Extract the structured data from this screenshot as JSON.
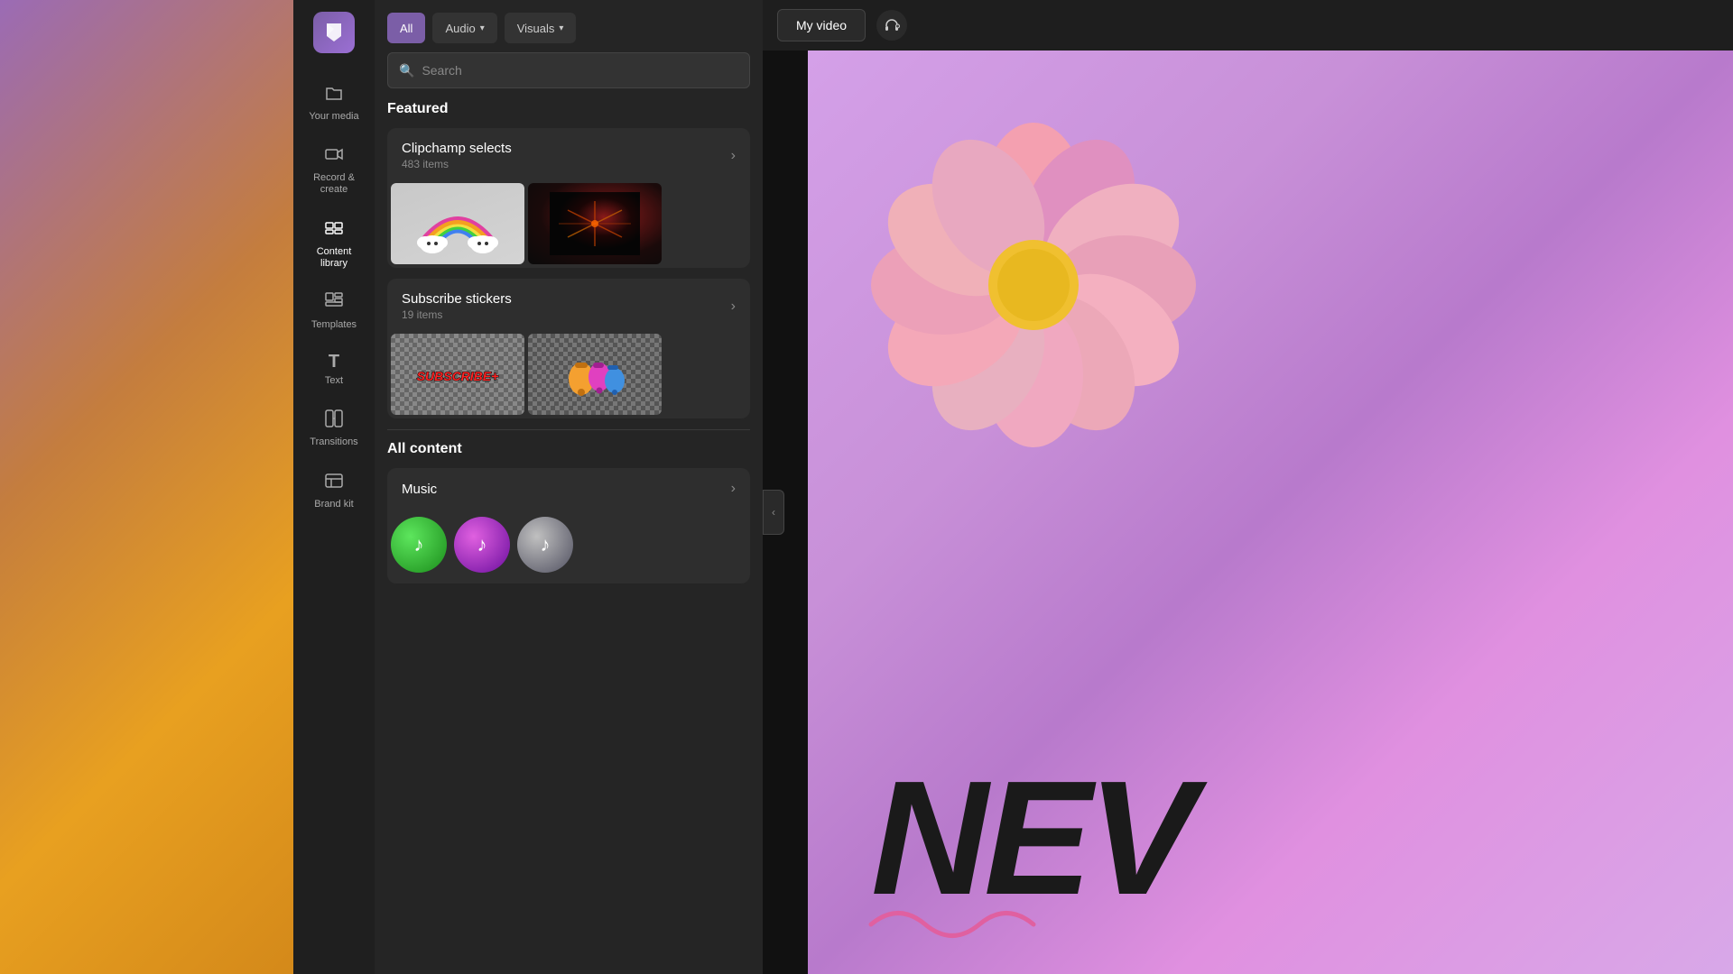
{
  "app": {
    "logo_label": "Clipchamp"
  },
  "sidebar": {
    "items": [
      {
        "id": "your-media",
        "label": "Your media",
        "icon": "📁"
      },
      {
        "id": "record-create",
        "label": "Record &\ncreate",
        "icon": "🎥"
      },
      {
        "id": "content-library",
        "label": "Content library",
        "icon": "🎞️",
        "active": true
      },
      {
        "id": "templates",
        "label": "Templates",
        "icon": "🧩"
      },
      {
        "id": "text",
        "label": "Text",
        "icon": "T"
      },
      {
        "id": "transitions",
        "label": "Transitions",
        "icon": "⊞"
      },
      {
        "id": "brand-kit",
        "label": "Brand kit",
        "icon": "🏷️"
      }
    ]
  },
  "filter_bar": {
    "all_label": "All",
    "audio_label": "Audio",
    "visuals_label": "Visuals"
  },
  "search": {
    "placeholder": "Search"
  },
  "featured": {
    "title": "Featured",
    "cards": [
      {
        "title": "Clipchamp selects",
        "subtitle": "483 items"
      },
      {
        "title": "Subscribe stickers",
        "subtitle": "19 items"
      }
    ]
  },
  "all_content": {
    "title": "All content",
    "cards": [
      {
        "title": "Music",
        "subtitle": ""
      }
    ]
  },
  "preview": {
    "my_video_label": "My video"
  }
}
